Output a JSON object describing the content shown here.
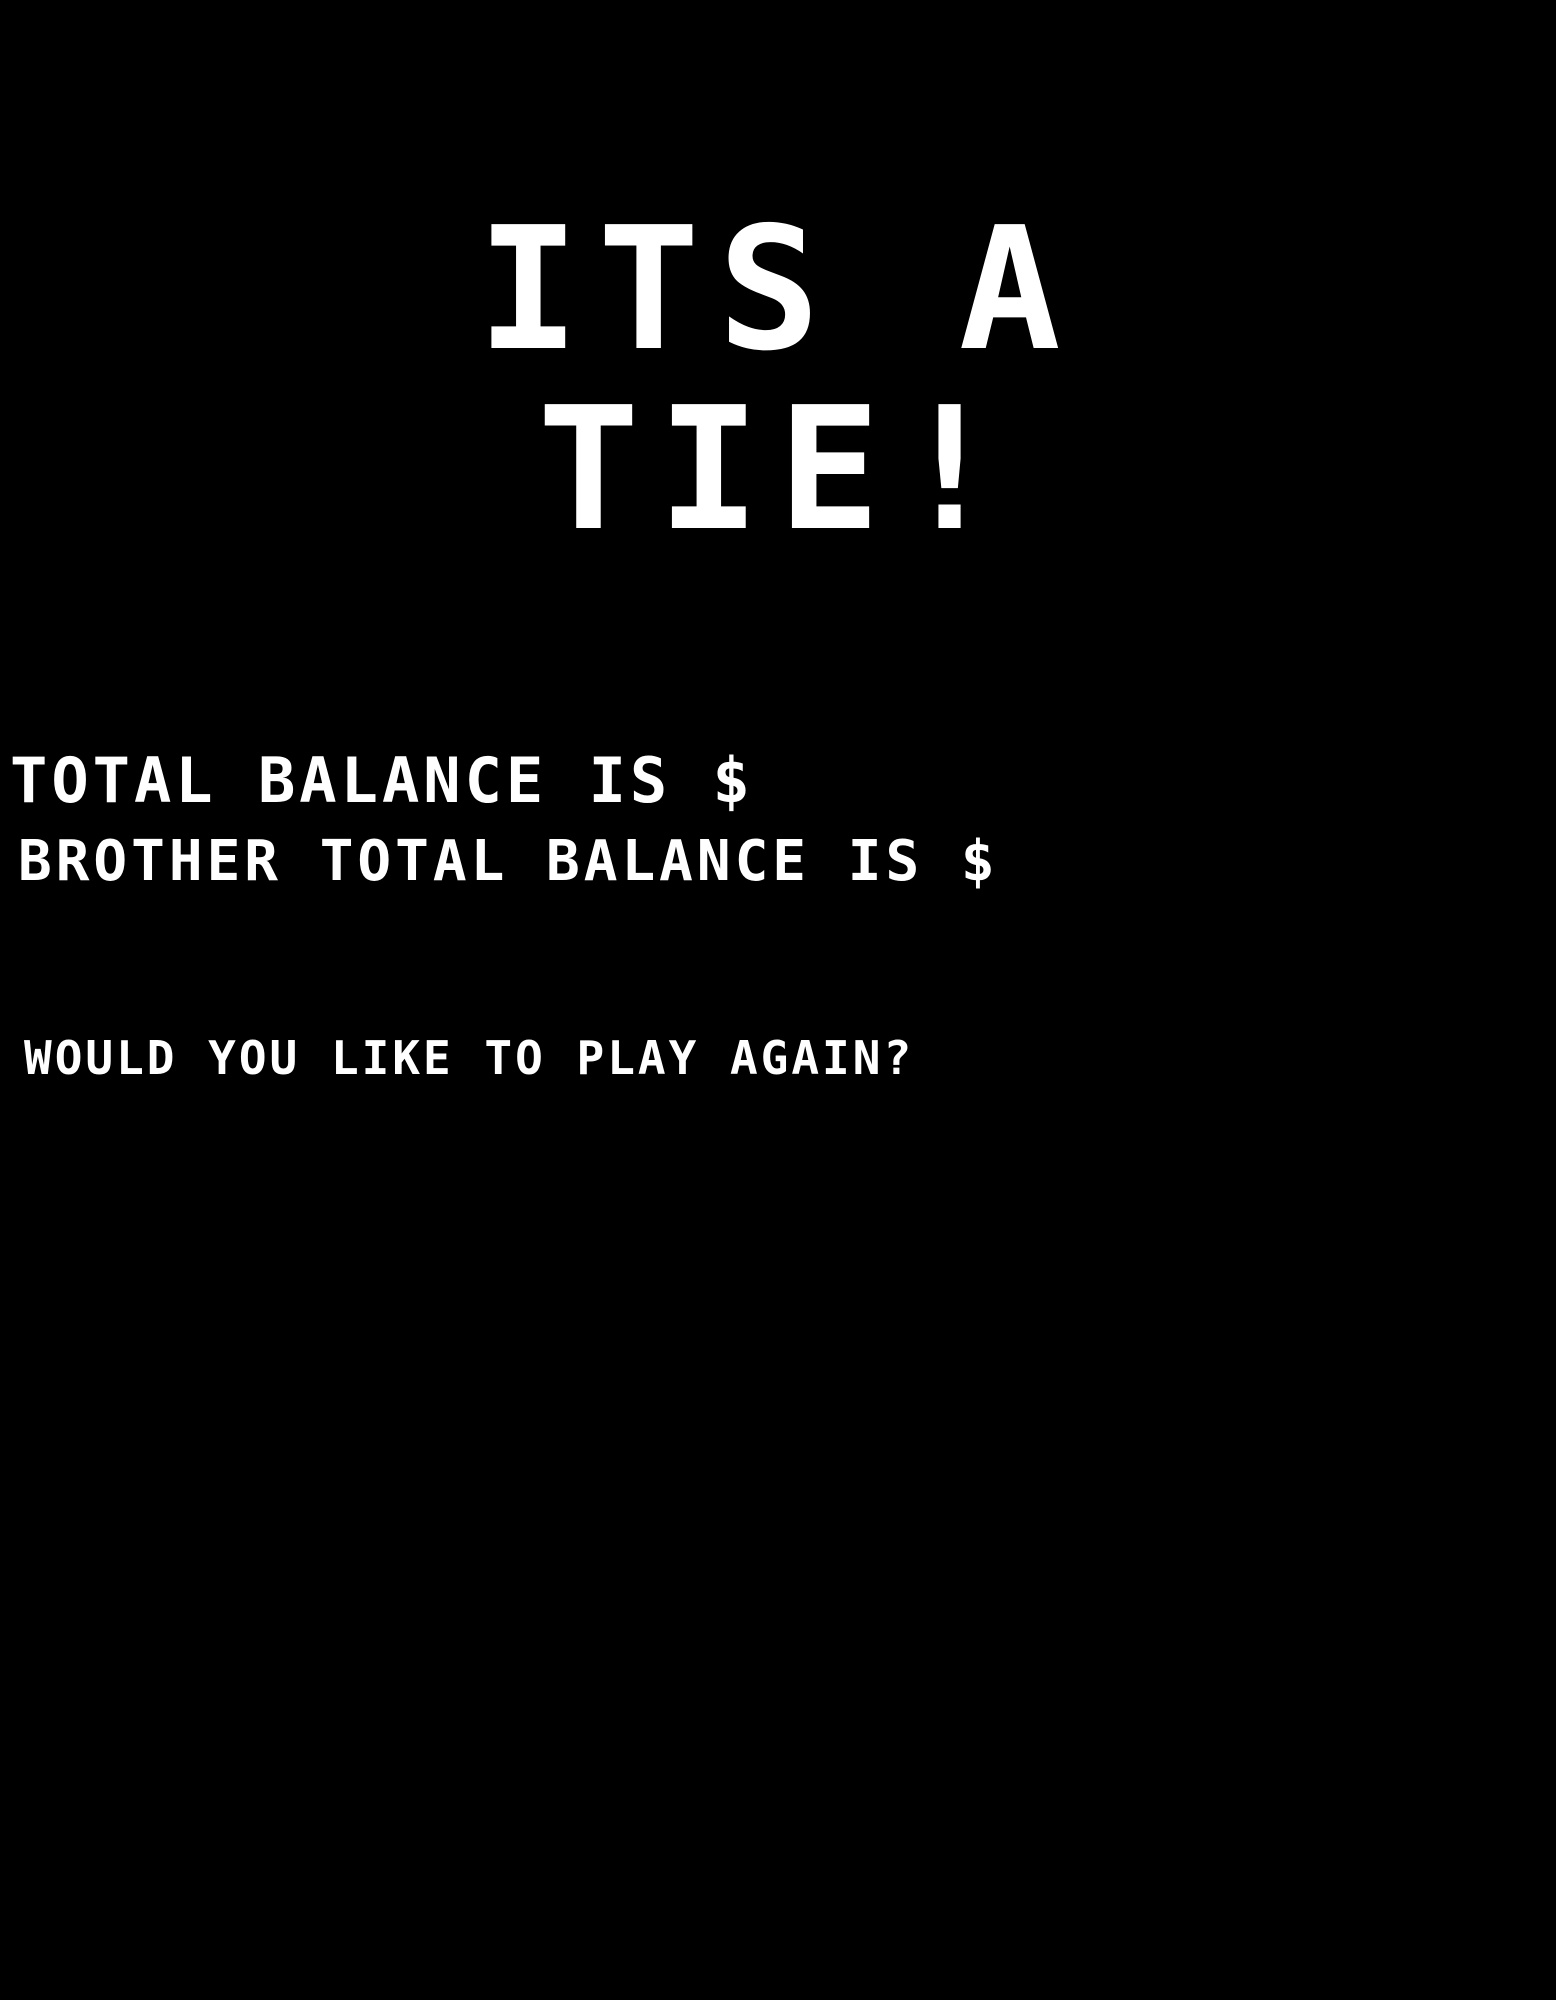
{
  "result": {
    "title_line1": "ITS A",
    "title_line2": "TIE!"
  },
  "balances": {
    "player_label": "TOTAL BALANCE IS $",
    "player_value": "",
    "brother_label": "BROTHER TOTAL BALANCE IS $",
    "brother_value": ""
  },
  "prompt": {
    "play_again": "WOULD YOU LIKE TO PLAY AGAIN?"
  },
  "colors": {
    "background": "#000000",
    "text": "#ffffff"
  }
}
